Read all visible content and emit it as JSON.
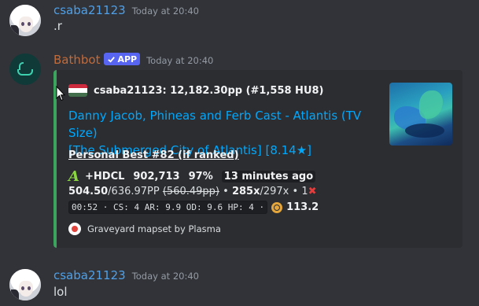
{
  "messages": [
    {
      "author": "csaba21123",
      "timestamp": "Today at 20:40",
      "text": ".r"
    },
    {
      "author": "Bathbot",
      "badge": "APP",
      "timestamp": "Today at 20:40"
    },
    {
      "author": "csaba21123",
      "timestamp": "Today at 20:40",
      "text": "lol"
    }
  ],
  "embed": {
    "accent_color": "#3ba55d",
    "flag": "hungary-flag",
    "author_line": "csaba21123: 12,182.30pp (#1,558 HU8)",
    "title_line1": "Danny Jacob, Phineas and Ferb Cast - Atlantis (TV Size)",
    "title_line2": "[The Submerged City of Atlantis] [8.14★]",
    "personal_best": "Personal Best #82 (if ranked)",
    "grade": "A",
    "mods": "+HDCL",
    "score": "902,713",
    "accuracy": "97%",
    "ago": "13 minutes ago",
    "pp": "504.50",
    "pp_max": "/636.97PP",
    "pp_old": "(560.49pp)",
    "sep": "•",
    "combo": "285x",
    "combo_max": "/297x",
    "misses": "1",
    "stats": [
      "00:52",
      "CS: 4",
      "AR: 9.9",
      "OD: 9.6",
      "HP: 4"
    ],
    "mod_stars": "113.2",
    "footer": "Graveyard mapset by Plasma"
  }
}
